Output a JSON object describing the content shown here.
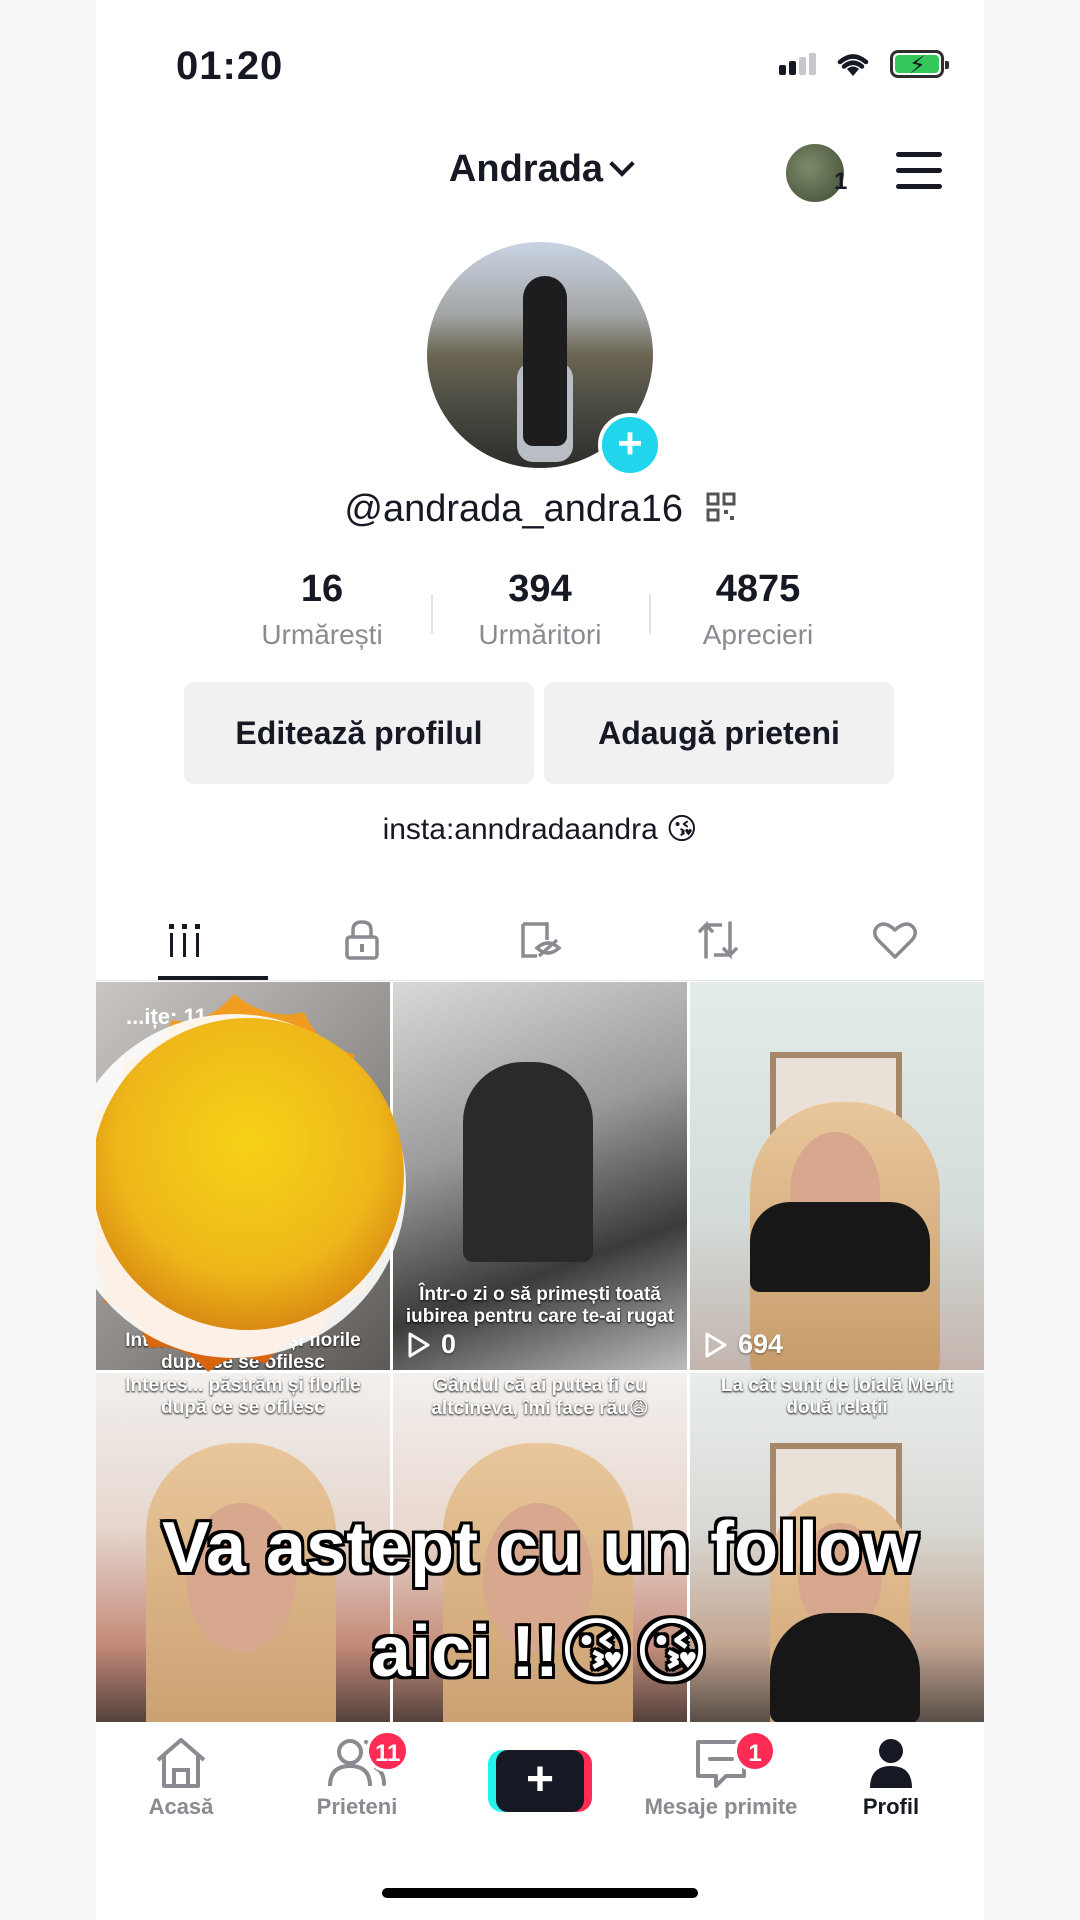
{
  "status_bar": {
    "time": "01:20"
  },
  "header": {
    "account_name": "Andrada",
    "switch_count": "1"
  },
  "profile": {
    "username": "@andrada_andra16",
    "stats": [
      {
        "value": "16",
        "label": "Urmărești"
      },
      {
        "value": "394",
        "label": "Urmăritori"
      },
      {
        "value": "4875",
        "label": "Aprecieri"
      }
    ],
    "edit_button": "Editează profilul",
    "add_friends_button": "Adaugă prieteni",
    "bio": "insta:anndradaandra 😘"
  },
  "tabs": [
    "videos-grid-icon",
    "private-lock-icon",
    "hidden-likes-icon",
    "repost-icon",
    "liked-heart-icon"
  ],
  "grid": {
    "cells": [
      {
        "pinned": "...ițe: 11",
        "caption_bottom": "Interes... păstrăm și florile după ce se ofilesc",
        "views": ""
      },
      {
        "caption": "Într-o zi o să primești toată iubirea pentru care te-ai rugat",
        "views": "0"
      },
      {
        "caption": "",
        "views": "694"
      },
      {
        "caption_top": "Interes... păstrăm și florile după ce se ofilesc"
      },
      {
        "caption_top": "Gândul că ai putea fi cu altcineva, îmi face rău😩"
      },
      {
        "caption_top": "La cât sunt de loială Merit două relații"
      }
    ]
  },
  "overlay": {
    "line1": "Va astept cu un follow",
    "line2": "aici !!😘😘"
  },
  "bottom_nav": {
    "home": "Acasă",
    "friends": "Prieteni",
    "friends_badge": "11",
    "inbox": "Mesaje primite",
    "inbox_badge": "1",
    "profile": "Profil"
  },
  "colors": {
    "accent_cyan": "#20d5ec",
    "accent_red": "#fe2c55",
    "text": "#161823"
  }
}
